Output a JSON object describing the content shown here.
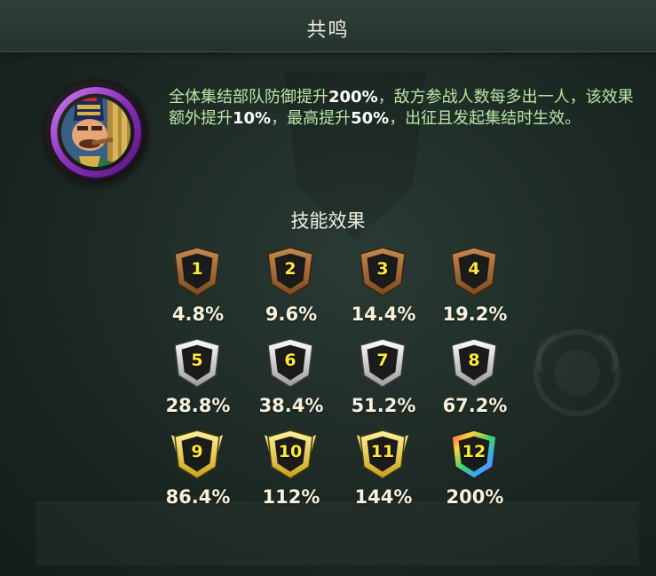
{
  "header": {
    "title": "共鸣"
  },
  "skill": {
    "description_parts": [
      {
        "text": "全体集结部队防御提升",
        "strong": false
      },
      {
        "text": "200%",
        "strong": true
      },
      {
        "text": "，敌方参战人数每多出一人，该效果额外提升",
        "strong": false
      },
      {
        "text": "10%",
        "strong": true
      },
      {
        "text": "，最高提升",
        "strong": false
      },
      {
        "text": "50%",
        "strong": true
      },
      {
        "text": "，出征且发起集结时生效。",
        "strong": false
      }
    ]
  },
  "effects": {
    "title": "技能效果",
    "levels": [
      {
        "level": "1",
        "value": "4.8%",
        "tier": "bronze"
      },
      {
        "level": "2",
        "value": "9.6%",
        "tier": "bronze"
      },
      {
        "level": "3",
        "value": "14.4%",
        "tier": "bronze"
      },
      {
        "level": "4",
        "value": "19.2%",
        "tier": "bronze"
      },
      {
        "level": "5",
        "value": "28.8%",
        "tier": "silver"
      },
      {
        "level": "6",
        "value": "38.4%",
        "tier": "silver"
      },
      {
        "level": "7",
        "value": "51.2%",
        "tier": "silver"
      },
      {
        "level": "8",
        "value": "67.2%",
        "tier": "silver"
      },
      {
        "level": "9",
        "value": "86.4%",
        "tier": "gold"
      },
      {
        "level": "10",
        "value": "112%",
        "tier": "gold"
      },
      {
        "level": "11",
        "value": "144%",
        "tier": "gold"
      },
      {
        "level": "12",
        "value": "200%",
        "tier": "rainbow"
      }
    ]
  },
  "colors": {
    "description_text": "#b9e6a6",
    "level_number": "#ffea3a",
    "avatar_ring": "#9b3fc6"
  },
  "icons": {
    "avatar": "commander-portrait-icon",
    "level_badge": "pentagon-badge-icon"
  }
}
